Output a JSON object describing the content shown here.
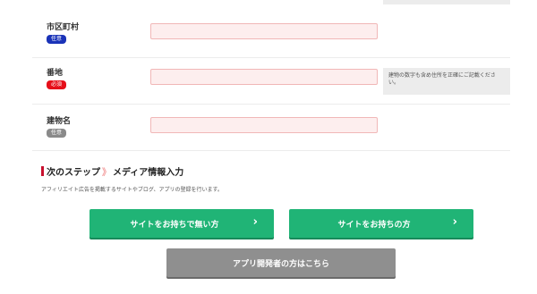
{
  "form": {
    "fields": [
      {
        "label": "市区町村",
        "badge": "任意",
        "badge_type": "optional"
      },
      {
        "label": "番地",
        "badge": "必須",
        "badge_type": "required",
        "hint": "建物の数字も含め住所を正確にご記載ください。"
      },
      {
        "label": "建物名",
        "badge": "任意",
        "badge_type": "grey"
      }
    ]
  },
  "next_step": {
    "prefix": "次のステップ",
    "arrow": "》",
    "title": "メディア情報入力",
    "description": "アフィリエイト広告を掲載するサイトやブログ、アプリの登録を行います。"
  },
  "buttons": {
    "no_site": "サイトをお持ちで無い方",
    "has_site": "サイトをお持ちの方",
    "app_dev": "アプリ開発者の方はこちら",
    "chevron": "›"
  },
  "colors": {
    "green": "#20b476",
    "grey_button": "#8f8f8f",
    "required": "#e60f1a",
    "optional": "#1a33b8",
    "accent": "#c8102e"
  }
}
